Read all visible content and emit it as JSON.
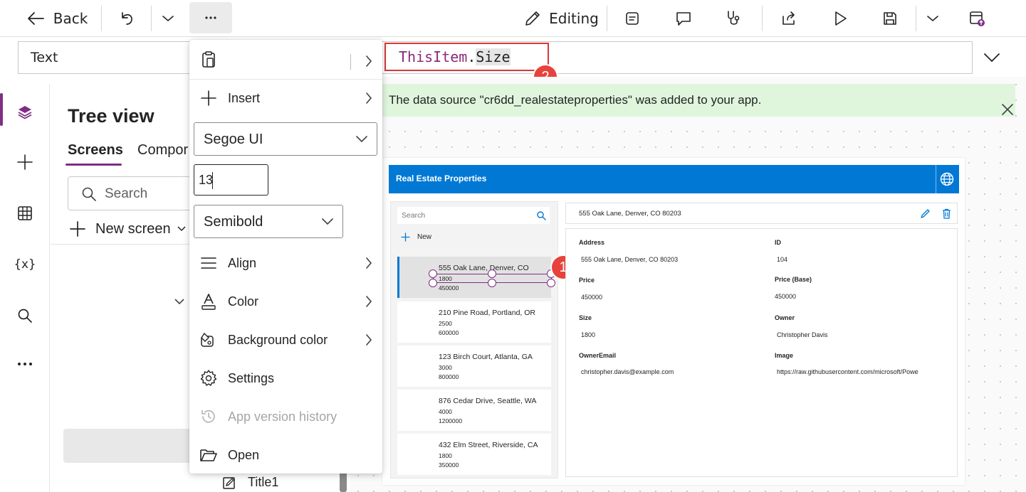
{
  "toolbar": {
    "back_label": "Back",
    "editing_label": "Editing"
  },
  "formula": {
    "property": "Text",
    "object": "ThisItem",
    "dot": ".",
    "field": "Size",
    "badge": "2"
  },
  "tree": {
    "title": "Tree view",
    "tabs": [
      "Screens",
      "Compor"
    ],
    "search_placeholder": "Search",
    "new_screen_label": "New screen",
    "bottom_item": "Title1"
  },
  "menu": {
    "insert_label": "Insert",
    "font_family": "Segoe UI",
    "font_size": "13",
    "font_weight": "Semibold",
    "align_label": "Align",
    "color_label": "Color",
    "background_color_label": "Background color",
    "settings_label": "Settings",
    "version_history_label": "App version history",
    "open_label": "Open"
  },
  "notice": {
    "message": "The data source \"cr6dd_realestateproperties\" was added to your app."
  },
  "app": {
    "title": "Real Estate Properties",
    "search_placeholder": "Search",
    "new_label": "New",
    "selected_badge": "1",
    "gallery": [
      {
        "address": "555 Oak Lane, Denver, CO",
        "size": "1800",
        "price": "450000"
      },
      {
        "address": "210 Pine Road, Portland, OR",
        "size": "2500",
        "price": "600000"
      },
      {
        "address": "123 Birch Court, Atlanta, GA",
        "size": "3000",
        "price": "800000"
      },
      {
        "address": "876 Cedar Drive, Seattle, WA",
        "size": "4000",
        "price": "1200000"
      },
      {
        "address": "432 Elm Street, Riverside, CA",
        "size": "1800",
        "price": "350000"
      }
    ],
    "detail": {
      "heading": "555 Oak Lane, Denver, CO 80203",
      "fields": [
        {
          "label": "Address",
          "value": "555 Oak Lane, Denver, CO 80203"
        },
        {
          "label": "ID",
          "value": "104"
        },
        {
          "label": "Price",
          "value": "450000"
        },
        {
          "label": "Price (Base)",
          "value": "450000"
        },
        {
          "label": "Size",
          "value": "1800"
        },
        {
          "label": "Owner",
          "value": "Christopher Davis"
        },
        {
          "label": "OwnerEmail",
          "value": "christopher.davis@example.com"
        },
        {
          "label": "Image",
          "value": "https://raw.githubusercontent.com/microsoft/Powe"
        }
      ]
    }
  },
  "colors": {
    "accent": "#7e2e84",
    "header_blue": "#0078d4",
    "badge_red": "#e8423c",
    "notice_green": "#dff6dd"
  }
}
